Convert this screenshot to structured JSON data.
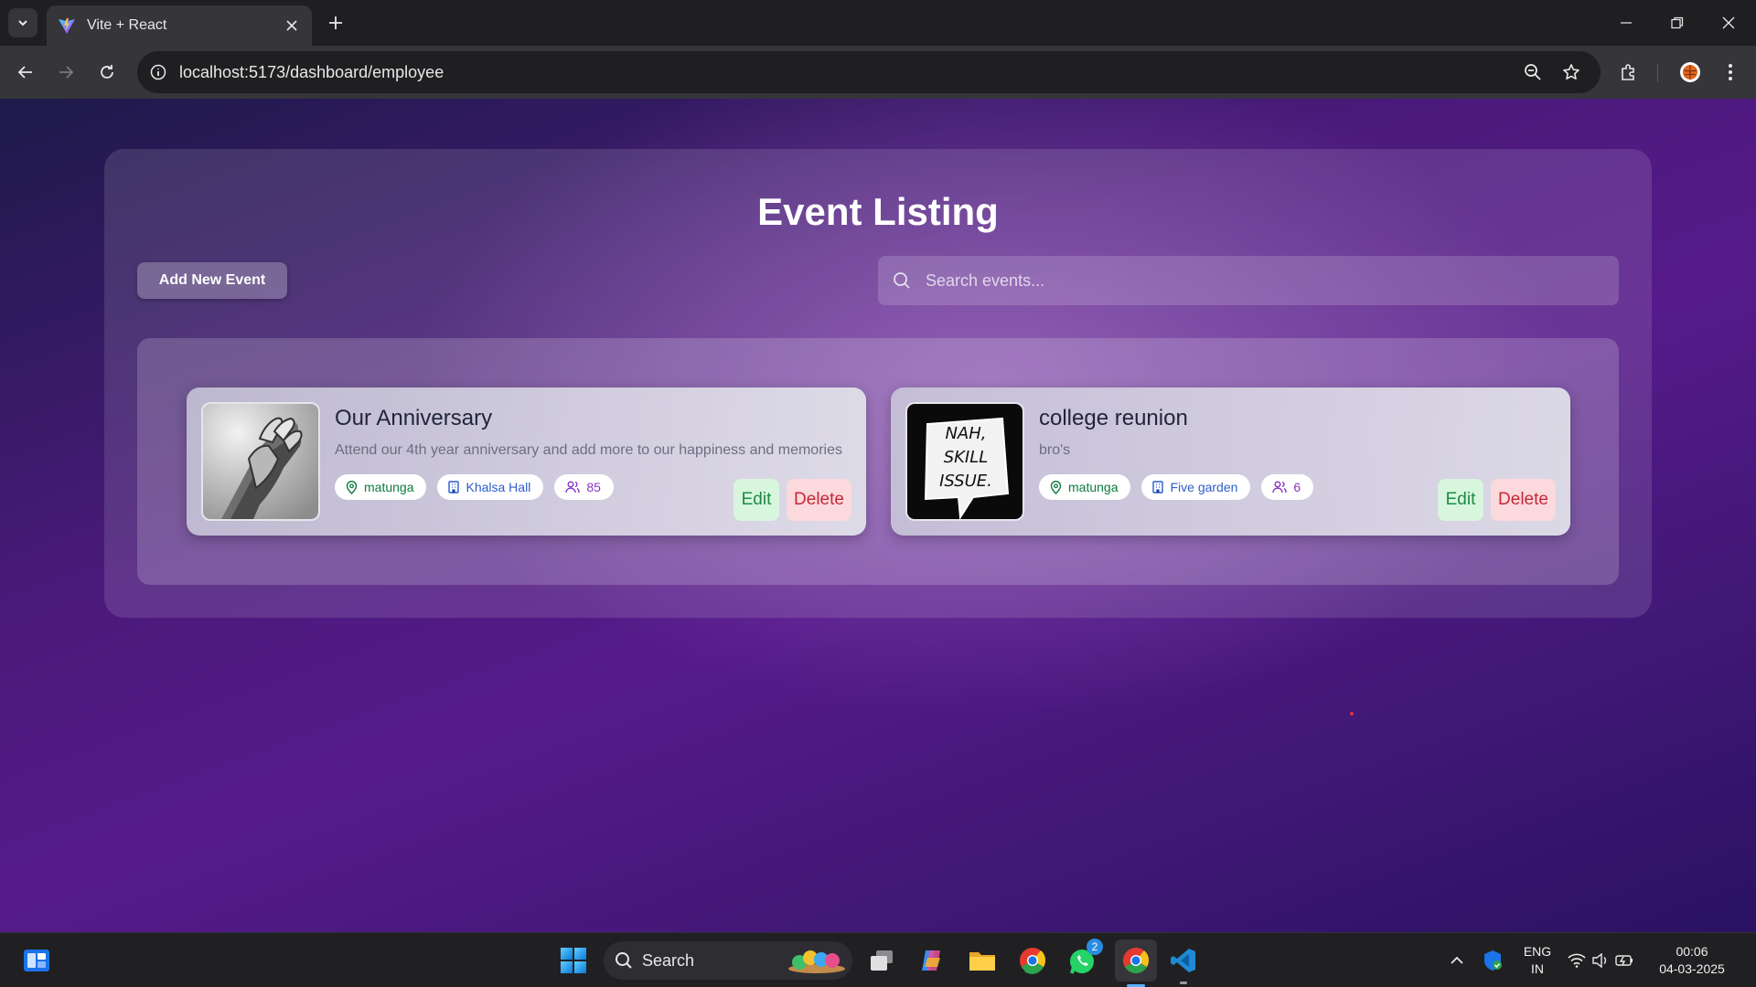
{
  "browser": {
    "tab_title": "Vite + React",
    "url": "localhost:5173/dashboard/employee"
  },
  "page": {
    "heading": "Event Listing",
    "add_button": "Add New Event",
    "search_placeholder": "Search events..."
  },
  "events": [
    {
      "title": "Our Anniversary",
      "description": "Attend our 4th year anniversary and add more to our happiness and memories",
      "location": "matunga",
      "venue": "Khalsa Hall",
      "attendees": "85",
      "edit_label": "Edit",
      "delete_label": "Delete",
      "image": "holding-hands-photo"
    },
    {
      "title": "college reunion",
      "description": "bro's",
      "location": "matunga",
      "venue": "Five garden",
      "attendees": "6",
      "edit_label": "Edit",
      "delete_label": "Delete",
      "image": "speech-bubble-graphic",
      "image_text": "NAH, SKILL ISSUE."
    }
  ],
  "taskbar": {
    "search_label": "Search",
    "lang_line1": "ENG",
    "lang_line2": "IN",
    "time": "00:06",
    "date": "04-03-2025",
    "whatsapp_badge": "2"
  },
  "colors": {
    "page_gradient_start": "#1d1a4a",
    "page_gradient_mid": "#561a8a",
    "edit_bg": "#d8f5de",
    "delete_bg": "#fbd9dc"
  }
}
